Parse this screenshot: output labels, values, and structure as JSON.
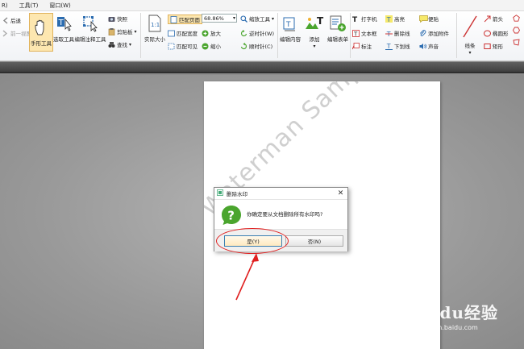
{
  "menu": {
    "items": [
      "R)",
      "工具(T)",
      "窗口(W)"
    ]
  },
  "ribbon": {
    "history": {
      "back": "后退",
      "forward": "前一视图"
    },
    "tools": {
      "hand": "手形工具",
      "select": "选取工具",
      "annotate": "编辑注释工具"
    },
    "clip": {
      "snapshot": "快照",
      "clipboard": "剪贴板",
      "find": "查找"
    },
    "actual_size": "实际大小",
    "fit": {
      "page": "匹配页面",
      "width": "匹配宽度",
      "visible": "匹配可见",
      "zoom_value": "68.86%",
      "zoom_in": "放大",
      "zoom_out": "缩小"
    },
    "zoom_tools": "缩放工具",
    "rotate": {
      "ccw": "逆时针(W)",
      "cw": "顺时针(C)"
    },
    "edit_content": "编辑内容",
    "add": "添加",
    "edit_form": "编辑表单",
    "typewriter": {
      "typewriter": "打字机",
      "textbox": "文本框",
      "callout": "标注"
    },
    "markup": {
      "highlight": "高亮",
      "strikeout": "删除线",
      "underline": "下划线"
    },
    "notes": {
      "sticky": "便贴",
      "attach": "添加附件",
      "sound": "声音"
    },
    "shapes": {
      "line": "线条",
      "arrow": "箭头",
      "ellipse": "椭圆形",
      "rect": "矩形"
    }
  },
  "document": {
    "watermark": "Waterman Sample"
  },
  "dialog": {
    "title": "删除水印",
    "message": "你确定要从文档删除所有水印吗?",
    "yes_label": "是(Y)",
    "no_label": "否(N)"
  },
  "logo": {
    "brand": "Baidu经验",
    "url": "jingyan.baidu.com"
  },
  "colors": {
    "annotation_red": "#e02020",
    "question_green": "#4aa52e",
    "ribbon_blue": "#2b6cb0"
  }
}
